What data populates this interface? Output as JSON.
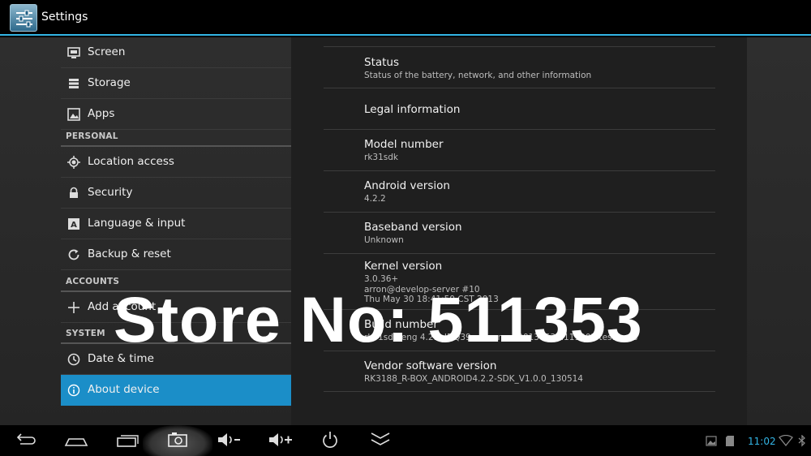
{
  "app": {
    "title": "Settings",
    "icon": "settings-icon"
  },
  "sidebar": {
    "items_top": [
      {
        "label": "Screen",
        "icon": "screen-icon"
      },
      {
        "label": "Storage",
        "icon": "storage-icon"
      },
      {
        "label": "Apps",
        "icon": "apps-icon"
      }
    ],
    "personal_header": "PERSONAL",
    "personal_items": [
      {
        "label": "Location access",
        "icon": "location-icon"
      },
      {
        "label": "Security",
        "icon": "lock-icon"
      },
      {
        "label": "Language & input",
        "icon": "language-icon"
      },
      {
        "label": "Backup & reset",
        "icon": "backup-icon"
      }
    ],
    "accounts_header": "ACCOUNTS",
    "accounts_items": [
      {
        "label": "Add account",
        "icon": "plus-icon"
      }
    ],
    "system_header": "SYSTEM",
    "system_items": [
      {
        "label": "Date & time",
        "icon": "clock-icon"
      },
      {
        "label": "About device",
        "icon": "info-icon",
        "selected": true
      }
    ]
  },
  "about": {
    "items": [
      {
        "title": "Status",
        "summary": "Status of the battery, network, and other information"
      },
      {
        "title": "Legal information",
        "summary": ""
      },
      {
        "title": "Model number",
        "summary": "rk31sdk"
      },
      {
        "title": "Android version",
        "summary": "4.2.2"
      },
      {
        "title": "Baseband version",
        "summary": "Unknown"
      },
      {
        "title": "Kernel version",
        "summary": "3.0.36+\narron@develop-server #10\nThu May 30 18:41:50 CST 2013"
      },
      {
        "title": "Build number",
        "summary": "rk31sdk-eng 4.2.2 JDQ39 eng.arron.20130531.111002 test-keys"
      },
      {
        "title": "Vendor software version",
        "summary": "RK3188_R-BOX_ANDROID4.2.2-SDK_V1.0.0_130514"
      }
    ]
  },
  "watermark": "Store No: 511353",
  "system_bar": {
    "buttons": [
      "back-icon",
      "home-icon",
      "recent-apps-icon",
      "screenshot-icon",
      "volume-down-icon",
      "volume-up-icon",
      "power-icon",
      "hide-bar-icon"
    ],
    "clock": "11:02",
    "status_icons": [
      "gallery-icon",
      "sdcard-icon",
      "wifi-icon",
      "bluetooth-icon"
    ]
  },
  "colors": {
    "accent": "#33b5e5",
    "selected_bg": "#1b8ec8"
  }
}
